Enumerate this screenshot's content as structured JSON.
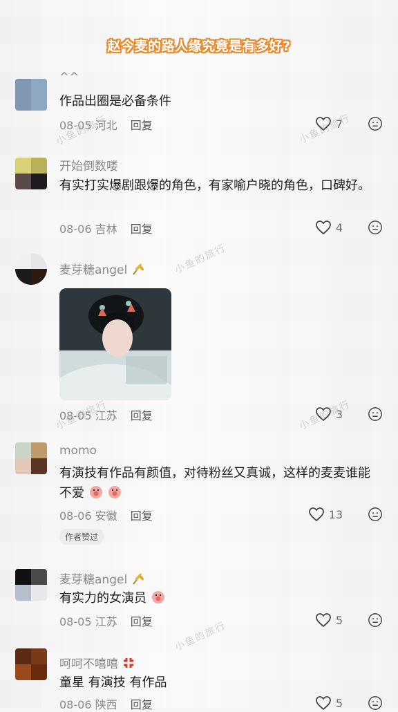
{
  "title": "赵今麦的路人缘究竟是有多好?",
  "watermark": "小鱼的旅行",
  "comments": [
    {
      "username": "^^",
      "text": "作品出圈是必备条件",
      "date": "08-05",
      "location": "河北",
      "reply_label": "回复",
      "likes": "7",
      "avatar_colors": [
        "#7f97b0",
        "#8ea8c2",
        "#7f97b0",
        "#8ea8c2"
      ]
    },
    {
      "username": "开始倒数喽",
      "text": "有实打实爆剧跟爆的角色，有家喻户晓的角色，口碑好。",
      "date": "08-06",
      "location": "吉林",
      "reply_label": "回复",
      "likes": "4",
      "avatar_colors": [
        "#d8d27a",
        "#b7b15a",
        "#5a4a4a",
        "#1d1b1d"
      ]
    },
    {
      "username": "麦芽糖angel",
      "text": "",
      "date": "08-05",
      "location": "江苏",
      "reply_label": "回复",
      "likes": "3",
      "avatar_colors": [
        "#f0f0f0",
        "#e6e6e6",
        "#1b1b1b",
        "#2a1a10"
      ]
    },
    {
      "username": "momo",
      "text": "有演技有作品有颜值，对待粉丝又真诚，这样的麦麦谁能不爱",
      "date": "08-06",
      "location": "安徽",
      "reply_label": "回复",
      "likes": "13",
      "author_liked": "作者赞过",
      "avatar_colors": [
        "#c9d3c6",
        "#c09a6a",
        "#e3c7b7",
        "#5a3424"
      ]
    },
    {
      "username": "麦芽糖angel",
      "text": "有实力的女演员",
      "date": "08-05",
      "location": "江苏",
      "reply_label": "回复",
      "likes": "5",
      "avatar_colors": [
        "#111111",
        "#4a4a4a",
        "#b8bfcc",
        "#e8e8ea"
      ]
    },
    {
      "username": "呵呵不嘻嘻",
      "text": "童星 有演技 有作品",
      "date": "08-06",
      "location": "陕西",
      "reply_label": "回复",
      "likes": "5",
      "avatar_colors": [
        "#5a2a14",
        "#7a3a1a",
        "#9a4a1a",
        "#6a2a10"
      ]
    }
  ],
  "icons": {
    "like": "heart-outline-icon",
    "dislike": "unhappy-face-icon",
    "wheat": "wheat-emoji",
    "angry": "anger-symbol-emoji",
    "pig": "pig-face-emoji"
  }
}
